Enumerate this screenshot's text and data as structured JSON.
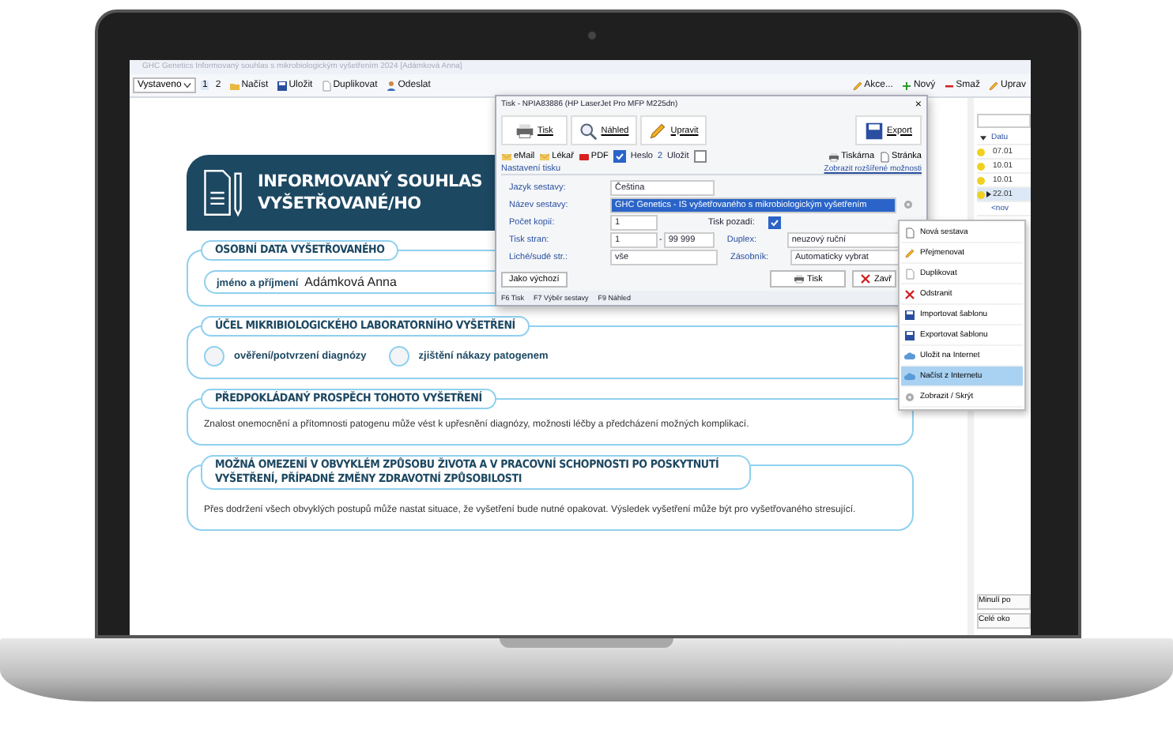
{
  "window": {
    "title": "GHC Genetics Informovaný souhlas s mikrobiologickým vyšetřením 2024 [Adámková Anna]"
  },
  "toolbar": {
    "dropdown": "Vystaveno",
    "pages": [
      {
        "label": "1",
        "selected": true
      },
      {
        "label": "2",
        "selected": false
      }
    ],
    "left_buttons": [
      {
        "label": "Načíst",
        "kind": "folder"
      },
      {
        "label": "Uložit",
        "kind": "save"
      },
      {
        "label": "Duplikovat",
        "kind": "copy"
      },
      {
        "label": "Odeslat",
        "kind": "person"
      }
    ],
    "right_buttons": [
      {
        "label": "Akce...",
        "kind": "pencil"
      },
      {
        "label": "Nový",
        "kind": "plus"
      },
      {
        "label": "Smaž",
        "kind": "minus"
      },
      {
        "label": "Uprav",
        "kind": "pencil"
      }
    ]
  },
  "document": {
    "title_lines": [
      "INFORMOVANÝ SOUHLAS",
      "VYŠETŘOVANÉ/HO"
    ],
    "sections": [
      {
        "kind": "field",
        "heading": "OSOBNÍ DATA VYŠETŘOVANÉHO",
        "label": "jméno a příjmení",
        "value": "Adámková Anna"
      },
      {
        "kind": "options",
        "heading": "ÚČEL MIKRIBIOLOGICKÉHO LABORATORNÍHO VYŠETŘENÍ",
        "options": [
          {
            "label": "ověření/potvrzení diagnózy",
            "selected": false
          },
          {
            "label": "zjištění nákazy patogenem",
            "selected": false
          }
        ]
      },
      {
        "kind": "text",
        "heading": "PŘEDPOKLÁDANÝ PROSPĚCH TOHOTO VYŠETŘENÍ",
        "text": "Znalost onemocnění a přítomnosti patogenu může vést k upřesnění diagnózy, možnosti léčby a předcházení možných komplikací."
      },
      {
        "kind": "text",
        "heading": "MOŽNÁ OMEZENÍ V OBVYKLÉM ZPŮSOBU ŽIVOTA A V PRACOVNÍ SCHOPNOSTI PO POSKYTNUTÍ VYŠETŘENÍ, PŘÍPADNÉ ZMĚNY ZDRAVOTNÍ ZPŮSOBILOSTI",
        "text": "Přes dodržení všech obvyklých postupů může nastat situace, že vyšetření bude nutné opakovat. Výsledek vyšetření může být pro vyšetřovaného stresující."
      }
    ]
  },
  "side_panel": {
    "column": "Datu",
    "rows": [
      {
        "date": "07.01",
        "current": false
      },
      {
        "date": "10.01",
        "current": false
      },
      {
        "date": "10.01",
        "current": false
      },
      {
        "date": "22.01",
        "current": true
      }
    ],
    "new_row": "<nov",
    "footer": [
      "Minulí po",
      "Celé oko"
    ]
  },
  "print_dialog": {
    "title": "Tisk - NPIA83886 (HP LaserJet Pro MFP M225dn)",
    "close": "×",
    "big_buttons": [
      {
        "label": "Tisk",
        "kind": "printer"
      },
      {
        "label": "Náhled",
        "kind": "magnifier"
      },
      {
        "label": "Upravit",
        "kind": "pencil"
      },
      {
        "label": "Export",
        "kind": "save"
      }
    ],
    "actions": [
      {
        "label": "eMail",
        "kind": "envelope"
      },
      {
        "label": "Lékař",
        "kind": "envelope"
      },
      {
        "label": "PDF",
        "kind": "pdf"
      }
    ],
    "password": {
      "label": "Heslo",
      "checked": true,
      "count": "2"
    },
    "save": {
      "label": "Uložit",
      "checked": false
    },
    "right_actions": [
      {
        "label": "Tiskárna",
        "kind": "printer"
      },
      {
        "label": "Stránka",
        "kind": "page"
      }
    ],
    "group": "Nastavení tisku",
    "more_link": "Zobrazit rozšířené možnosti",
    "language": {
      "label": "Jazyk sestavy:",
      "value": "Čeština"
    },
    "report": {
      "label": "Název sestavy:",
      "value": "GHC Genetics - IS vyšetřovaného s mikrobiologickým vyšetřením"
    },
    "copies": {
      "label": "Počet kopií:",
      "value": "1"
    },
    "background": {
      "label": "Tisk pozadí:",
      "checked": true
    },
    "pages": {
      "label": "Tisk stran:",
      "from": "1",
      "dash": "-",
      "to": "99 999"
    },
    "duplex": {
      "label": "Duplex:",
      "value": "neuzový ruční"
    },
    "odd_even": {
      "label": "Liché/sudé str.:",
      "value": "vše"
    },
    "tray": {
      "label": "Zásobník:",
      "value": "Automaticky vybrat"
    },
    "default_button": "Jako výchozí",
    "print_button": "Tisk",
    "close_button": "Zavř",
    "shortcuts": [
      "F6 Tisk",
      "F7 Výběr sestavy",
      "F9 Náhled"
    ]
  },
  "context_menu": {
    "items": [
      {
        "label": "Nová sestava",
        "kind": "page",
        "selected": false
      },
      {
        "label": "Přejmenovat",
        "kind": "pencil",
        "selected": false
      },
      {
        "label": "Duplikovat",
        "kind": "copy",
        "selected": false
      },
      {
        "label": "Odstranit",
        "kind": "cross",
        "selected": false
      },
      {
        "label": "Importovat šablonu",
        "kind": "save",
        "selected": false
      },
      {
        "label": "Exportovat šablonu",
        "kind": "save",
        "selected": false
      },
      {
        "label": "Uložit na Internet",
        "kind": "cloud",
        "selected": false
      },
      {
        "label": "Načíst z Internetu",
        "kind": "cloud",
        "selected": true
      },
      {
        "label": "Zobrazit / Skrýt",
        "kind": "gear",
        "selected": false
      }
    ]
  }
}
